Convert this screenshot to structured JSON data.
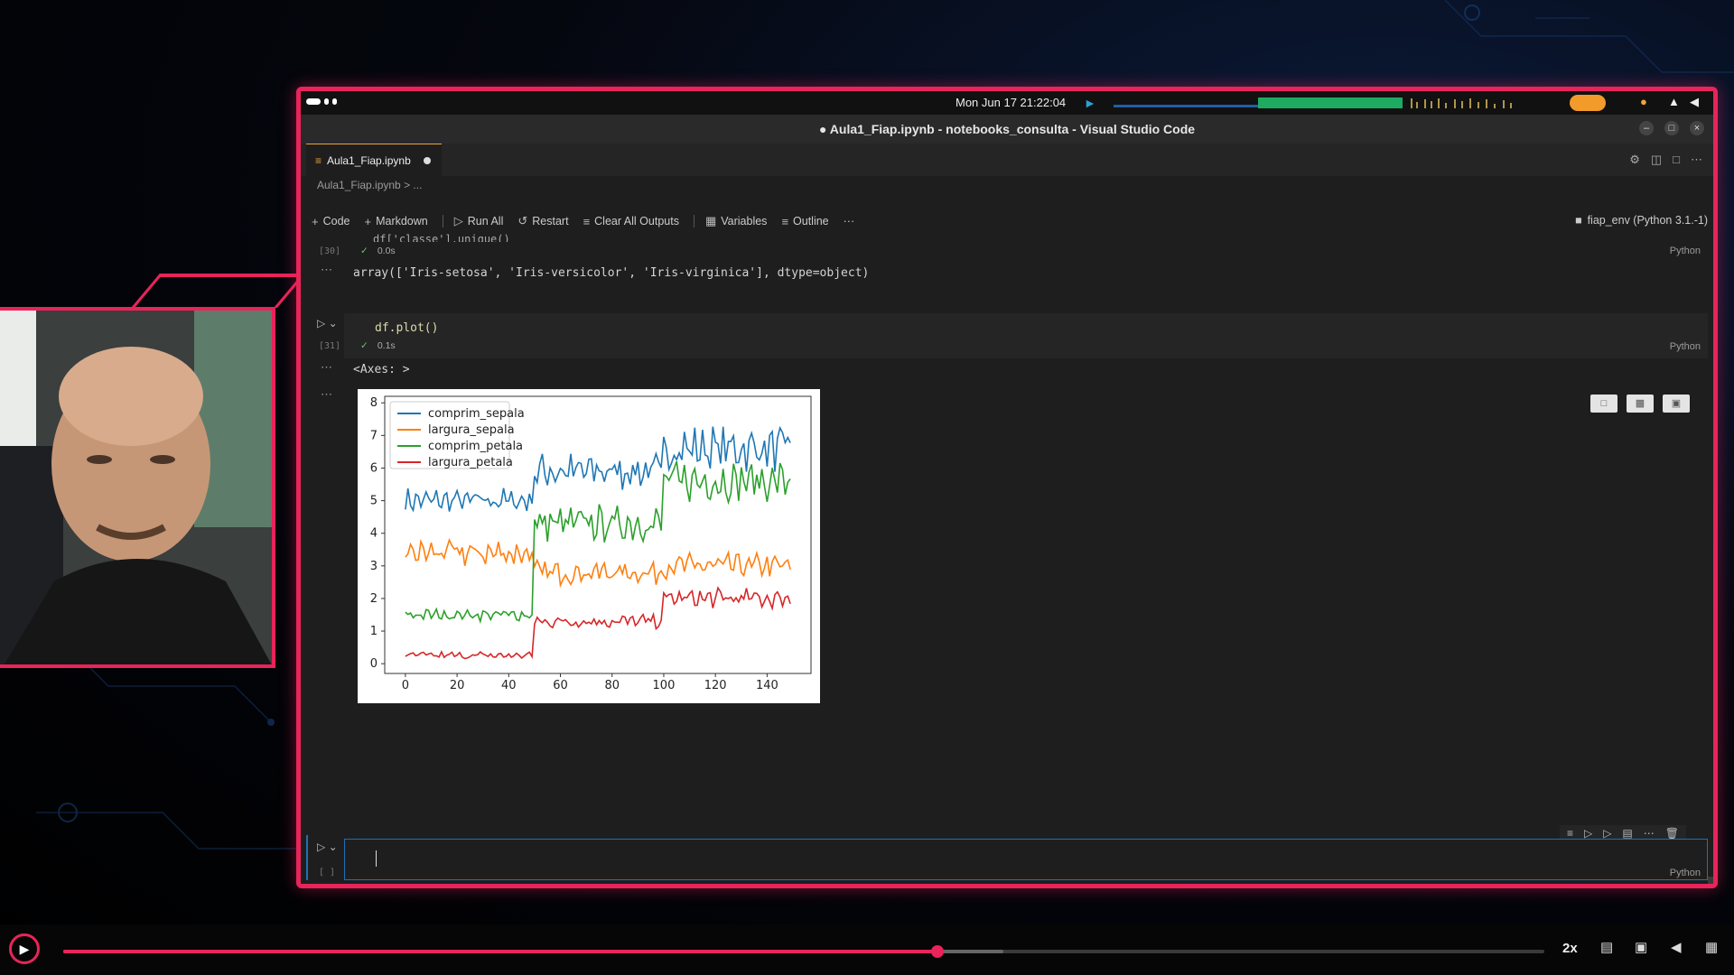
{
  "system": {
    "clock": "Mon Jun 17  21:22:04"
  },
  "window": {
    "title": "● Aula1_Fiap.ipynb - notebooks_consulta - Visual Studio Code"
  },
  "tab": {
    "label": "Aula1_Fiap.ipynb",
    "breadcrumb": "Aula1_Fiap.ipynb > ..."
  },
  "toolbar": {
    "code": "Code",
    "markdown": "Markdown",
    "run_all": "Run All",
    "restart": "Restart",
    "clear_outputs": "Clear All Outputs",
    "variables": "Variables",
    "outline": "Outline",
    "more": "···",
    "kernel": "fiap_env (Python 3.1.-1)"
  },
  "cells": {
    "c30": {
      "code_partial": "df['classe'].unique()",
      "exec": "[30]",
      "time": "0.0s",
      "lang": "Python",
      "output": "array(['Iris-setosa', 'Iris-versicolor', 'Iris-virginica'], dtype=object)"
    },
    "c31": {
      "code": "df.plot()",
      "exec": "[31]",
      "time": "0.1s",
      "lang": "Python",
      "output": "<Axes: >"
    },
    "new": {
      "exec": "[ ]",
      "lang": "Python"
    }
  },
  "chart_data": {
    "type": "line",
    "xlim": [
      -8,
      157
    ],
    "ylim": [
      -0.3,
      8.2
    ],
    "xticks": [
      0,
      20,
      40,
      60,
      80,
      100,
      120,
      140
    ],
    "yticks": [
      0,
      1,
      2,
      3,
      4,
      5,
      6,
      7,
      8
    ],
    "legend_position": "top-left",
    "series": [
      {
        "name": "comprim_sepala",
        "color": "#1f77b4",
        "segments": [
          {
            "x_start": 0,
            "x_end": 49,
            "base": 5.0,
            "amp": 0.3
          },
          {
            "x_start": 50,
            "x_end": 99,
            "base": 5.9,
            "amp": 0.45
          },
          {
            "x_start": 100,
            "x_end": 149,
            "base": 6.6,
            "amp": 0.55
          }
        ]
      },
      {
        "name": "largura_sepala",
        "color": "#ff7f0e",
        "segments": [
          {
            "x_start": 0,
            "x_end": 49,
            "base": 3.4,
            "amp": 0.35
          },
          {
            "x_start": 50,
            "x_end": 99,
            "base": 2.8,
            "amp": 0.3
          },
          {
            "x_start": 100,
            "x_end": 149,
            "base": 3.0,
            "amp": 0.3
          }
        ]
      },
      {
        "name": "comprim_petala",
        "color": "#2ca02c",
        "segments": [
          {
            "x_start": 0,
            "x_end": 49,
            "base": 1.5,
            "amp": 0.15
          },
          {
            "x_start": 50,
            "x_end": 99,
            "base": 4.3,
            "amp": 0.45
          },
          {
            "x_start": 100,
            "x_end": 149,
            "base": 5.6,
            "amp": 0.5
          }
        ]
      },
      {
        "name": "largura_petala",
        "color": "#d62728",
        "segments": [
          {
            "x_start": 0,
            "x_end": 49,
            "base": 0.25,
            "amp": 0.1
          },
          {
            "x_start": 50,
            "x_end": 99,
            "base": 1.3,
            "amp": 0.18
          },
          {
            "x_start": 100,
            "x_end": 149,
            "base": 2.0,
            "amp": 0.25
          }
        ]
      }
    ]
  },
  "player": {
    "speed": "2x",
    "progress": 0.59,
    "buffered": 0.635
  }
}
